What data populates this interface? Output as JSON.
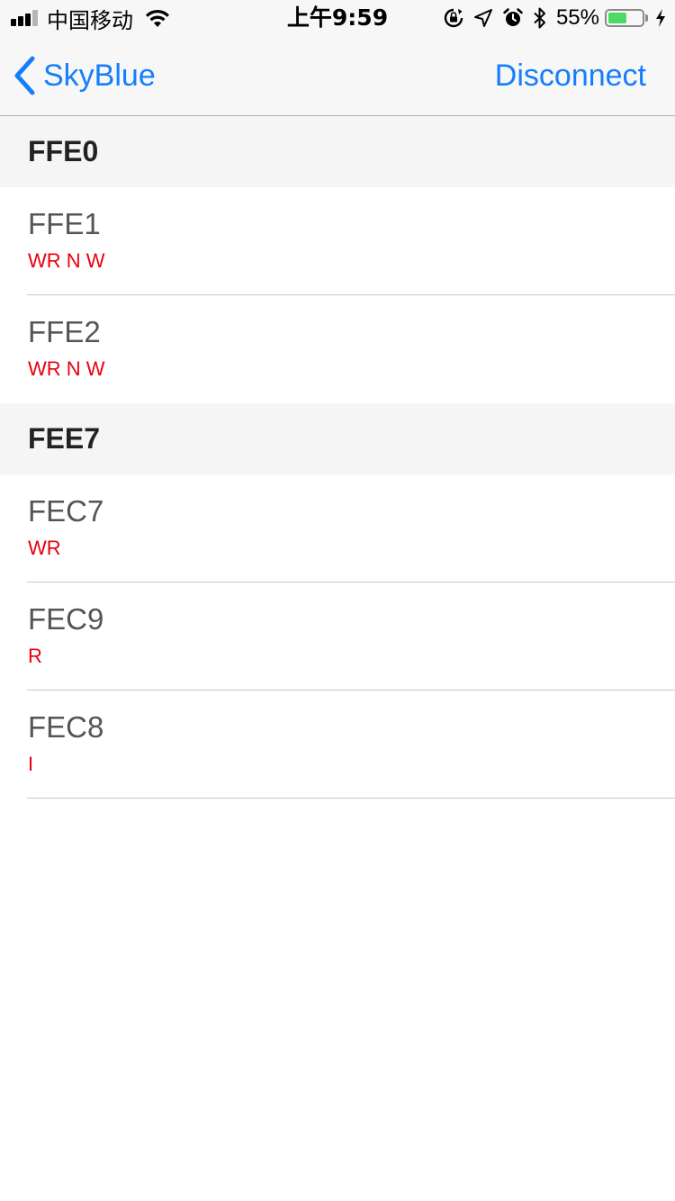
{
  "status_bar": {
    "carrier": "中国移动",
    "time": "上午9:59",
    "battery_percent": "55%",
    "battery_level": 0.55,
    "icons": [
      "signal-icon",
      "wifi-icon",
      "orientation-lock-icon",
      "location-icon",
      "alarm-icon",
      "bluetooth-icon",
      "battery-icon",
      "charging-icon"
    ]
  },
  "nav": {
    "back_label": "SkyBlue",
    "right_label": "Disconnect",
    "accent_color": "#157efb"
  },
  "sections": [
    {
      "header": "FFE0",
      "rows": [
        {
          "title": "FFE1",
          "props": "WR N W"
        },
        {
          "title": "FFE2",
          "props": "WR N W"
        }
      ]
    },
    {
      "header": "FEE7",
      "rows": [
        {
          "title": "FEC7",
          "props": "WR"
        },
        {
          "title": "FEC9",
          "props": "R"
        },
        {
          "title": "FEC8",
          "props": "I"
        }
      ]
    }
  ],
  "colors": {
    "property_text": "#e8000e",
    "section_background": "#f5f5f5"
  }
}
